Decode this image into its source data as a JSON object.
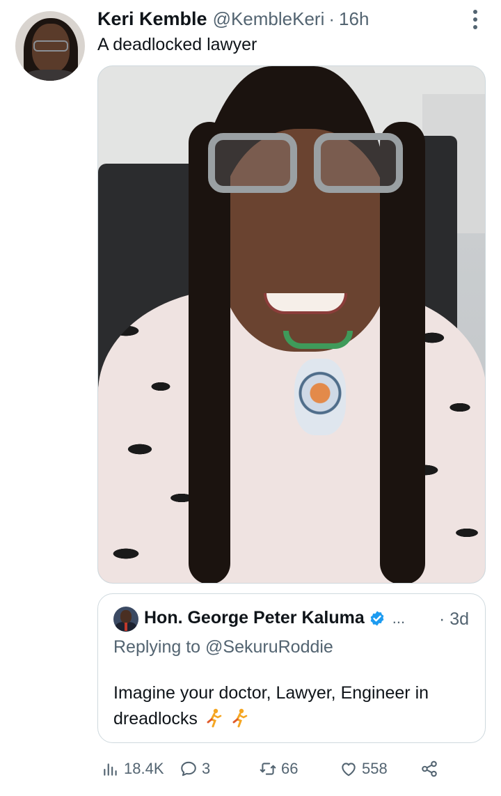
{
  "tweet": {
    "display_name": "Keri Kemble",
    "handle": "@KembleKeri",
    "separator": "·",
    "time": "16h",
    "text": "A deadlocked lawyer"
  },
  "quoted_tweet": {
    "display_name": "Hon. George Peter Kaluma",
    "ellipsis": "...",
    "time": "· 3d",
    "replying_to": "Replying to @SekuruRoddie",
    "text": "Imagine your doctor, Lawyer, Engineer in dreadlocks"
  },
  "actions": {
    "views": "18.4K",
    "replies": "3",
    "retweets": "66",
    "likes": "558"
  },
  "colors": {
    "text_primary": "#0f1419",
    "text_secondary": "#536471",
    "border": "#cfd9de",
    "verified": "#1d9bf0"
  },
  "icons": [
    "more-icon",
    "verified-icon",
    "runner-emoji-icon",
    "views-icon",
    "reply-icon",
    "retweet-icon",
    "like-icon",
    "share-icon"
  ]
}
